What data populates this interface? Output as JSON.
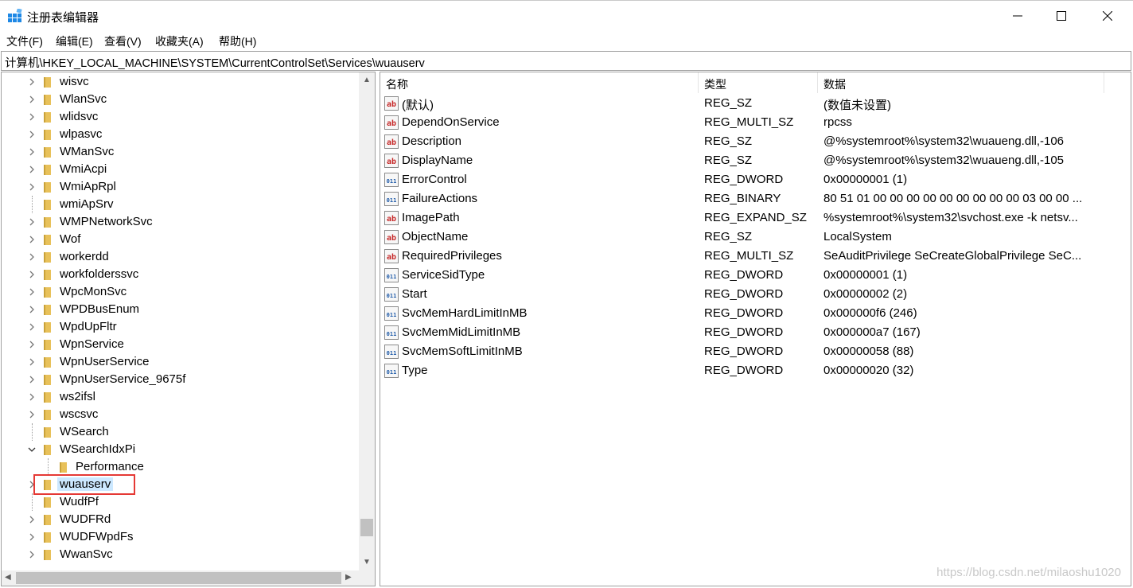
{
  "window": {
    "title": "注册表编辑器",
    "icon": "regedit-icon"
  },
  "menu": [
    "文件(F)",
    "编辑(E)",
    "查看(V)",
    "收藏夹(A)",
    "帮助(H)"
  ],
  "address": "计算机\\HKEY_LOCAL_MACHINE\\SYSTEM\\CurrentControlSet\\Services\\wuauserv",
  "tree": [
    {
      "label": "wisvc",
      "expander": "collapsed",
      "indent": 0
    },
    {
      "label": "WlanSvc",
      "expander": "collapsed",
      "indent": 0
    },
    {
      "label": "wlidsvc",
      "expander": "collapsed",
      "indent": 0
    },
    {
      "label": "wlpasvc",
      "expander": "collapsed",
      "indent": 0
    },
    {
      "label": "WManSvc",
      "expander": "collapsed",
      "indent": 0
    },
    {
      "label": "WmiAcpi",
      "expander": "collapsed",
      "indent": 0
    },
    {
      "label": "WmiApRpl",
      "expander": "collapsed",
      "indent": 0
    },
    {
      "label": "wmiApSrv",
      "expander": "none",
      "indent": 0
    },
    {
      "label": "WMPNetworkSvc",
      "expander": "collapsed",
      "indent": 0
    },
    {
      "label": "Wof",
      "expander": "collapsed",
      "indent": 0
    },
    {
      "label": "workerdd",
      "expander": "collapsed",
      "indent": 0
    },
    {
      "label": "workfolderssvc",
      "expander": "collapsed",
      "indent": 0
    },
    {
      "label": "WpcMonSvc",
      "expander": "collapsed",
      "indent": 0
    },
    {
      "label": "WPDBusEnum",
      "expander": "collapsed",
      "indent": 0
    },
    {
      "label": "WpdUpFltr",
      "expander": "collapsed",
      "indent": 0
    },
    {
      "label": "WpnService",
      "expander": "collapsed",
      "indent": 0
    },
    {
      "label": "WpnUserService",
      "expander": "collapsed",
      "indent": 0
    },
    {
      "label": "WpnUserService_9675f",
      "expander": "collapsed",
      "indent": 0
    },
    {
      "label": "ws2ifsl",
      "expander": "collapsed",
      "indent": 0
    },
    {
      "label": "wscsvc",
      "expander": "collapsed",
      "indent": 0
    },
    {
      "label": "WSearch",
      "expander": "none",
      "indent": 0
    },
    {
      "label": "WSearchIdxPi",
      "expander": "expanded",
      "indent": 0
    },
    {
      "label": "Performance",
      "expander": "none",
      "indent": 1
    },
    {
      "label": "wuauserv",
      "expander": "collapsed",
      "indent": 0,
      "selected": true
    },
    {
      "label": "WudfPf",
      "expander": "none",
      "indent": 0
    },
    {
      "label": "WUDFRd",
      "expander": "collapsed",
      "indent": 0
    },
    {
      "label": "WUDFWpdFs",
      "expander": "collapsed",
      "indent": 0
    },
    {
      "label": "WwanSvc",
      "expander": "collapsed",
      "indent": 0
    }
  ],
  "columns": {
    "name": "名称",
    "type": "类型",
    "data": "数据"
  },
  "values": [
    {
      "icon": "string-value-icon",
      "name": "(默认)",
      "type": "REG_SZ",
      "data": "(数值未设置)"
    },
    {
      "icon": "string-value-icon",
      "name": "DependOnService",
      "type": "REG_MULTI_SZ",
      "data": "rpcss"
    },
    {
      "icon": "string-value-icon",
      "name": "Description",
      "type": "REG_SZ",
      "data": "@%systemroot%\\system32\\wuaueng.dll,-106"
    },
    {
      "icon": "string-value-icon",
      "name": "DisplayName",
      "type": "REG_SZ",
      "data": "@%systemroot%\\system32\\wuaueng.dll,-105"
    },
    {
      "icon": "binary-value-icon",
      "name": "ErrorControl",
      "type": "REG_DWORD",
      "data": "0x00000001 (1)"
    },
    {
      "icon": "binary-value-icon",
      "name": "FailureActions",
      "type": "REG_BINARY",
      "data": "80 51 01 00 00 00 00 00 00 00 00 00 03 00 00 ..."
    },
    {
      "icon": "string-value-icon",
      "name": "ImagePath",
      "type": "REG_EXPAND_SZ",
      "data": "%systemroot%\\system32\\svchost.exe -k netsv..."
    },
    {
      "icon": "string-value-icon",
      "name": "ObjectName",
      "type": "REG_SZ",
      "data": "LocalSystem"
    },
    {
      "icon": "string-value-icon",
      "name": "RequiredPrivileges",
      "type": "REG_MULTI_SZ",
      "data": "SeAuditPrivilege SeCreateGlobalPrivilege SeC..."
    },
    {
      "icon": "binary-value-icon",
      "name": "ServiceSidType",
      "type": "REG_DWORD",
      "data": "0x00000001 (1)"
    },
    {
      "icon": "binary-value-icon",
      "name": "Start",
      "type": "REG_DWORD",
      "data": "0x00000002 (2)"
    },
    {
      "icon": "binary-value-icon",
      "name": "SvcMemHardLimitInMB",
      "type": "REG_DWORD",
      "data": "0x000000f6 (246)"
    },
    {
      "icon": "binary-value-icon",
      "name": "SvcMemMidLimitInMB",
      "type": "REG_DWORD",
      "data": "0x000000a7 (167)"
    },
    {
      "icon": "binary-value-icon",
      "name": "SvcMemSoftLimitInMB",
      "type": "REG_DWORD",
      "data": "0x00000058 (88)"
    },
    {
      "icon": "binary-value-icon",
      "name": "Type",
      "type": "REG_DWORD",
      "data": "0x00000020 (32)"
    }
  ],
  "watermark": "https://blog.csdn.net/milaoshu1020",
  "colors": {
    "selection": "#cce8ff",
    "highlight_box": "#e53935",
    "folder": "#e8c15a"
  }
}
